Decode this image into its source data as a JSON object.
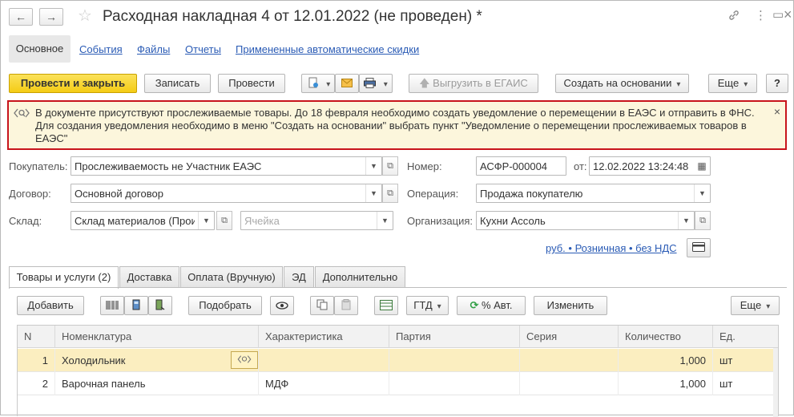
{
  "window": {
    "title": "Расходная накладная 4 от 12.01.2022 (не проведен) *",
    "back_icon": "←",
    "forward_icon": "→",
    "star_icon": "☆",
    "link_icon": "🔗",
    "menu_icon": "⋮",
    "restore_icon": "▭",
    "close_icon": "×"
  },
  "sections": {
    "active": "Основное",
    "links": [
      "События",
      "Файлы",
      "Отчеты",
      "Примененные автоматические скидки"
    ]
  },
  "toolbar": {
    "post_close": "Провести и закрыть",
    "save": "Записать",
    "post": "Провести",
    "egais": "Выгрузить в ЕГАИС",
    "create_based": "Создать на основании",
    "more": "Еще",
    "help": "?"
  },
  "warning": {
    "text": "В документе присутствуют прослеживаемые товары. До 18 февраля необходимо создать уведомление о перемещении в ЕАЭС и отправить в ФНС. Для создания уведомления необходимо в меню \"Создать на основании\" выбрать пункт \"Уведомление о перемещении прослеживаемых товаров в ЕАЭС\"",
    "close": "×"
  },
  "form": {
    "buyer_label": "Покупатель:",
    "buyer": "Прослеживаемость не Участник ЕАЭС",
    "contract_label": "Договор:",
    "contract": "Основной договор",
    "warehouse_label": "Склад:",
    "warehouse": "Склад материалов (Произ",
    "cell_placeholder": "Ячейка",
    "number_label": "Номер:",
    "number": "АСФР-000004",
    "date_label": "от:",
    "date": "12.02.2022 13:24:48",
    "operation_label": "Операция:",
    "operation": "Продажа покупателю",
    "org_label": "Организация:",
    "org": "Кухни Ассоль",
    "prices_link": "руб. • Розничная • без НДС"
  },
  "tabs": [
    "Товары и услуги (2)",
    "Доставка",
    "Оплата (Вручную)",
    "ЭД",
    "Дополнительно"
  ],
  "table_toolbar": {
    "add": "Добавить",
    "pick": "Подобрать",
    "gtd": "ГТД",
    "auto_pct": "% Авт.",
    "change": "Изменить",
    "more": "Еще"
  },
  "table": {
    "columns": [
      "N",
      "Номенклатура",
      "Характеристика",
      "Партия",
      "Серия",
      "Количество",
      "Ед."
    ],
    "rows": [
      {
        "n": "1",
        "name": "Холодильник",
        "char": "",
        "batch": "",
        "series": "",
        "qty": "1,000",
        "unit": "шт"
      },
      {
        "n": "2",
        "name": "Варочная панель",
        "char": "МДФ",
        "batch": "",
        "series": "",
        "qty": "1,000",
        "unit": "шт"
      }
    ]
  },
  "colors": {
    "accent_yellow": "#f4cc15",
    "warning_border": "#c8141c",
    "warning_bg": "#fcf6dc",
    "link_blue": "#2a5bb5",
    "selected_row": "#fbeec0"
  }
}
